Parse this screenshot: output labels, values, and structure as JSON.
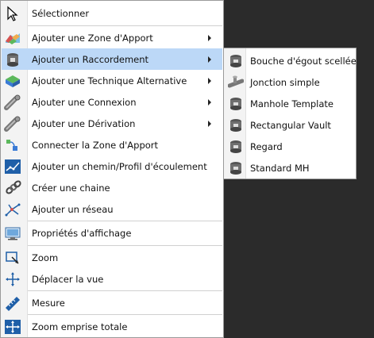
{
  "main_menu": {
    "items": [
      {
        "label": "Sélectionner",
        "icon": "cursor-arrow-icon"
      },
      {
        "label": "Ajouter une Zone d'Apport",
        "icon": "catchment-area-icon",
        "submenu": true
      },
      {
        "label": "Ajouter un Raccordement",
        "icon": "junction-manhole-icon",
        "submenu": true,
        "highlighted": true
      },
      {
        "label": "Ajouter une Technique Alternative",
        "icon": "alternative-technique-icon",
        "submenu": true
      },
      {
        "label": "Ajouter une Connexion",
        "icon": "pipe-connection-icon",
        "submenu": true
      },
      {
        "label": "Ajouter une Dérivation",
        "icon": "pipe-derivation-icon",
        "submenu": true
      },
      {
        "label": "Connecter la Zone d'Apport",
        "icon": "connect-catchment-icon"
      },
      {
        "label": "Ajouter un chemin/Profil d'écoulement",
        "icon": "flow-path-icon"
      },
      {
        "label": "Créer une chaine",
        "icon": "chain-icon"
      },
      {
        "label": "Ajouter un réseau",
        "icon": "network-icon"
      },
      {
        "label": "Propriétés d'affichage",
        "icon": "display-properties-icon"
      },
      {
        "label": "Zoom",
        "icon": "zoom-window-icon"
      },
      {
        "label": "Déplacer la vue",
        "icon": "pan-view-icon"
      },
      {
        "label": "Mesure",
        "icon": "measure-ruler-icon"
      },
      {
        "label": "Zoom emprise totale",
        "icon": "zoom-extents-icon"
      }
    ]
  },
  "sub_menu": {
    "items": [
      {
        "label": "Bouche d'égout scellée",
        "icon": "sealed-manhole-icon"
      },
      {
        "label": "Jonction simple",
        "icon": "simple-junction-icon"
      },
      {
        "label": "Manhole Template",
        "icon": "manhole-template-icon"
      },
      {
        "label": "Rectangular Vault",
        "icon": "rectangular-vault-icon"
      },
      {
        "label": "Regard",
        "icon": "regard-icon"
      },
      {
        "label": "Standard MH",
        "icon": "standard-mh-icon"
      }
    ]
  },
  "colors": {
    "highlight": "#bcd8f7",
    "gutter": "#f3f3f3",
    "background": "#2b2b2b"
  }
}
